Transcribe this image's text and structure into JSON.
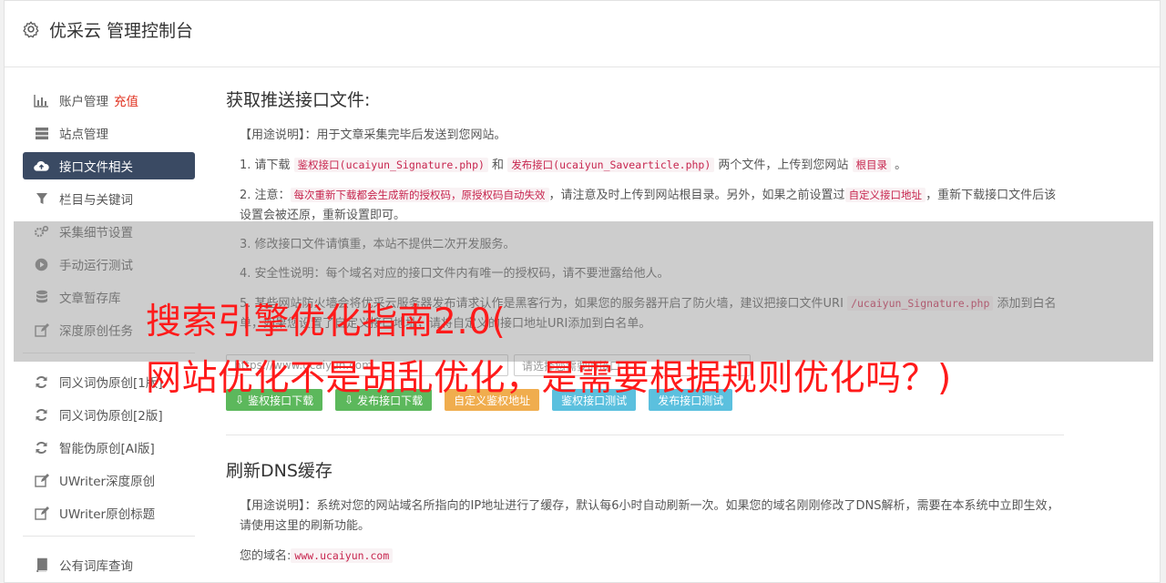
{
  "header": {
    "title": "优采云 管理控制台"
  },
  "sidebar": {
    "items": [
      {
        "label": "账户管理",
        "extra": "充值",
        "icon": "bar-chart-icon"
      },
      {
        "label": "站点管理",
        "icon": "server-icon"
      },
      {
        "label": "接口文件相关",
        "icon": "cloud-upload-icon",
        "active": true
      },
      {
        "label": "栏目与关键词",
        "icon": "filter-icon"
      },
      {
        "label": "采集细节设置",
        "icon": "cogs-icon"
      },
      {
        "label": "手动运行测试",
        "icon": "play-icon"
      },
      {
        "label": "文章暂存库",
        "icon": "database-icon"
      },
      {
        "label": "深度原创任务",
        "icon": "edit-icon"
      }
    ],
    "items2": [
      {
        "label": "同义词伪原创[1版]",
        "icon": "refresh-icon"
      },
      {
        "label": "同义词伪原创[2版]",
        "icon": "refresh-icon"
      },
      {
        "label": "智能伪原创[AI版]",
        "icon": "refresh-icon"
      },
      {
        "label": "UWriter深度原创",
        "icon": "edit-icon"
      },
      {
        "label": "UWriter原创标题",
        "icon": "edit-icon"
      }
    ],
    "items3": [
      {
        "label": "公有词库查询",
        "icon": "book-icon"
      }
    ]
  },
  "section1": {
    "title": "获取推送接口文件:",
    "usage_label": "【用途说明】",
    "usage_text": "：用于文章采集完毕后发送到您网站。",
    "l1_a": "1. 请下载 ",
    "l1_code1": "鉴权接口(ucaiyun_Signature.php)",
    "l1_b": " 和 ",
    "l1_code2": "发布接口(ucaiyun_Savearticle.php)",
    "l1_c": " 两个文件，上传到您网站 ",
    "l1_code3": "根目录",
    "l1_d": " 。",
    "l2_a": "2. 注意：",
    "l2_code1": "每次重新下载都会生成新的授权码，原授权码自动失效",
    "l2_b": "，请注意及时上传到网站根目录。另外，如果之前设置过",
    "l2_code2": "自定义接口地址",
    "l2_c": "，重新下载接口文件后该设置会被还原，重新设置即可。",
    "l3": "3. 修改接口文件请慎重，本站不提供二次开发服务。",
    "l4": "4. 安全性说明：每个域名对应的接口文件内有唯一的授权码，请不要泄露给他人。",
    "l5_a": "5. 某些网站防火墙会将优采云服务器发布请求认作是黑客行为，如果您的服务器开启了防火墙，建议把接口文件URI ",
    "l5_code": "/ucaiyun_Signature.php",
    "l5_b": " 添加到白名单，如果您设置了自定义接口地址，请将自定义的接口地址URI添加到白名单。",
    "input_value": "https://www.ucaiyun.com",
    "select_value": "请选择您需要的接口",
    "buttons": {
      "b1": "鉴权接口下载",
      "b2": "发布接口下载",
      "b3": "自定义鉴权地址",
      "b4": "鉴权接口测试",
      "b5": "发布接口测试"
    }
  },
  "section2": {
    "title": "刷新DNS缓存",
    "usage_label": "【用途说明】",
    "usage_text": "：系统对您的网站域名所指向的IP地址进行了缓存，默认每6小时自动刷新一次。如果您的域名刚刚修改了DNS解析，需要在本系统中立即生效，请使用这里的刷新功能。",
    "domain_label": "您的域名:",
    "domain_value": "www.ucaiyun.com"
  },
  "overlay": {
    "line1": "搜索引擎优化指南2.0(",
    "line2": "网站优化不是胡乱优化，是需要根据规则优化吗？)"
  },
  "colors": {
    "sidebar_active": "#3a4a63",
    "green": "#5cb85c",
    "orange": "#f0ad4e",
    "blue": "#5bc0de",
    "red_text": "#e0301e"
  }
}
